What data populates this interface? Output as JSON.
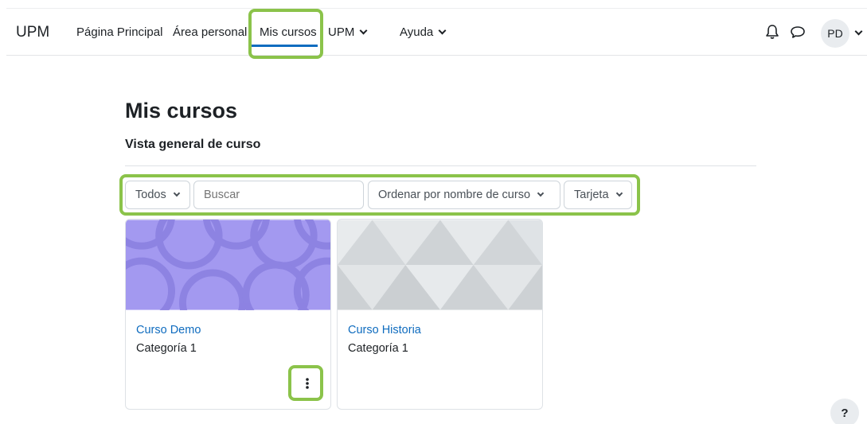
{
  "nav": {
    "brand": "UPM",
    "items": [
      {
        "label": "Página Principal"
      },
      {
        "label": "Área personal"
      },
      {
        "label": "Mis cursos",
        "active": true
      },
      {
        "label": "UPM",
        "has_dropdown": true
      },
      {
        "label": "Ayuda",
        "has_dropdown": true
      }
    ],
    "icons": [
      "bell-icon",
      "chat-bubble-icon"
    ],
    "user_initials": "PD"
  },
  "page": {
    "title": "Mis cursos",
    "subtitle": "Vista general de curso"
  },
  "filters": {
    "grouping": "Todos",
    "search_placeholder": "Buscar",
    "sort": "Ordenar por nombre de curso",
    "view": "Tarjeta"
  },
  "courses": [
    {
      "name": "Curso Demo",
      "category": "Categoría 1",
      "image_color": "#a399f0"
    },
    {
      "name": "Curso Historia",
      "category": "Categoría 1",
      "image_color": "#dfe3e6"
    }
  ],
  "help": {
    "label": "?"
  },
  "colors": {
    "accent": "#0f6cbf",
    "highlight": "#8bc34a"
  }
}
